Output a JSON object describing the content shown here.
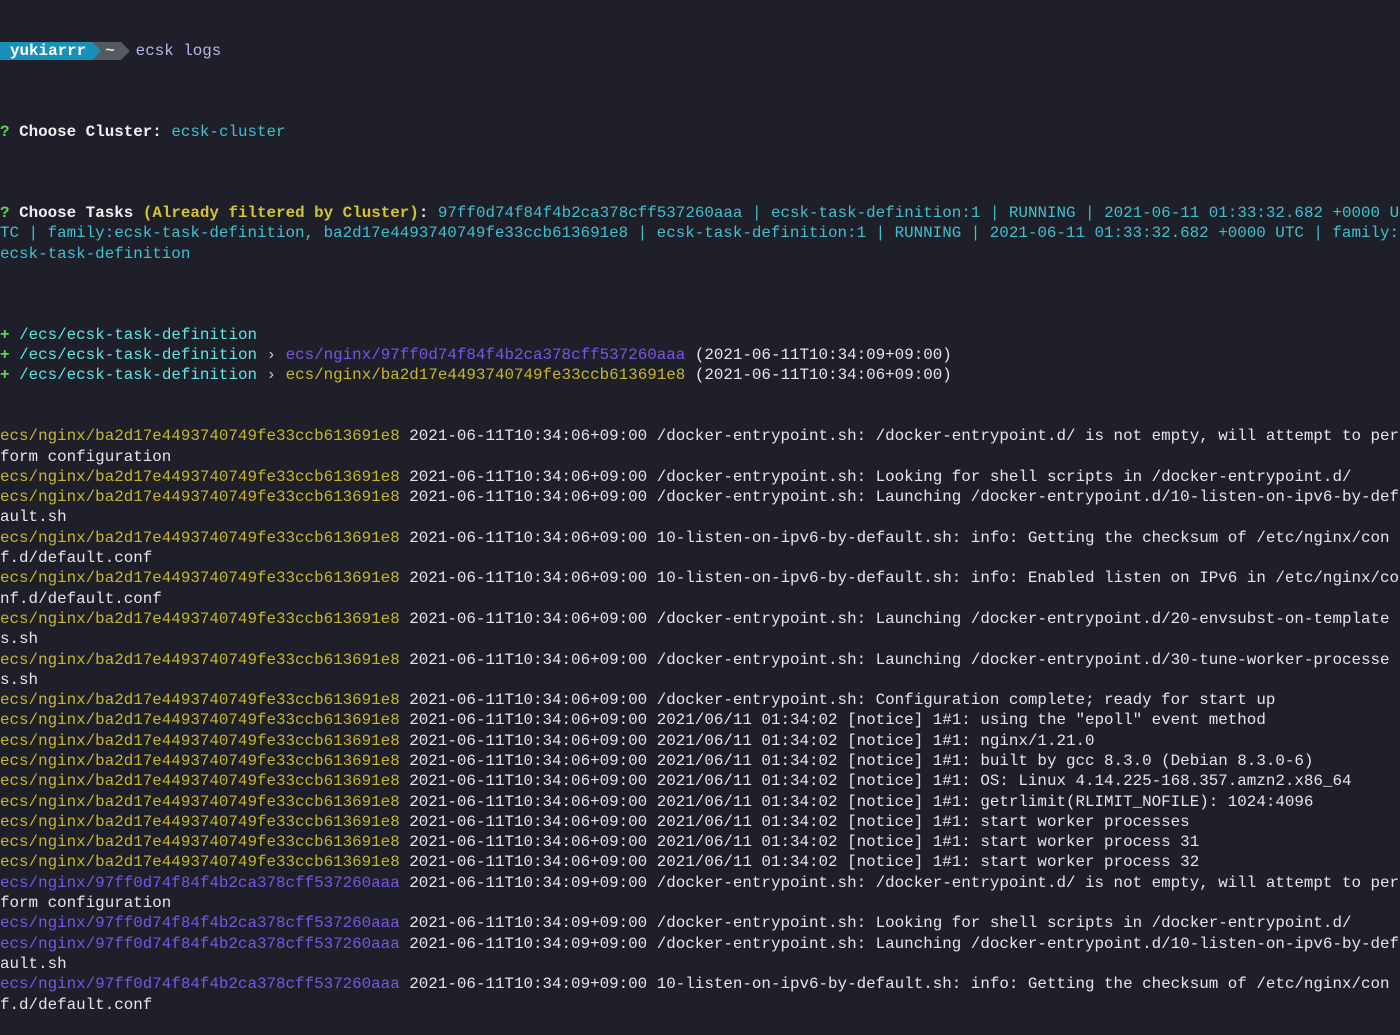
{
  "prompt": {
    "user": "yukiarrr",
    "dir": "~",
    "command": "ecsk logs",
    "colors": {
      "user_bg": "#1a8fb8",
      "dir_bg": "#555a5f"
    }
  },
  "questions": [
    {
      "mark": "?",
      "label": "Choose Cluster:",
      "hint": "",
      "answer": "ecsk-cluster"
    },
    {
      "mark": "?",
      "label": "Choose Tasks",
      "hint": "(Already filtered by Cluster)",
      "colon": ":",
      "answer": "97ff0d74f84f4b2ca378cff537260aaa | ecsk-task-definition:1 | RUNNING | 2021-06-11 01:33:32.682 +0000 UTC | family:ecsk-task-definition, ba2d17e4493740749fe33ccb613691e8 | ecsk-task-definition:1 | RUNNING | 2021-06-11 01:33:32.682 +0000 UTC | family:ecsk-task-definition"
    }
  ],
  "streams": [
    {
      "mark": "+",
      "group": "/ecs/ecsk-task-definition",
      "sep": "",
      "stream": "",
      "time": "",
      "color": ""
    },
    {
      "mark": "+",
      "group": "/ecs/ecsk-task-definition",
      "sep": " › ",
      "stream": "ecs/nginx/97ff0d74f84f4b2ca378cff537260aaa",
      "time": " (2021-06-11T10:34:09+09:00)",
      "color": "purple"
    },
    {
      "mark": "+",
      "group": "/ecs/ecsk-task-definition",
      "sep": " › ",
      "stream": "ecs/nginx/ba2d17e4493740749fe33ccb613691e8",
      "time": " (2021-06-11T10:34:06+09:00)",
      "color": "yellow"
    }
  ],
  "logs": [
    {
      "stream": "ecs/nginx/ba2d17e4493740749fe33ccb613691e8",
      "color": "yellow",
      "time": "2021-06-11T10:34:06+09:00",
      "msg": "/docker-entrypoint.sh: /docker-entrypoint.d/ is not empty, will attempt to perform configuration"
    },
    {
      "stream": "ecs/nginx/ba2d17e4493740749fe33ccb613691e8",
      "color": "yellow",
      "time": "2021-06-11T10:34:06+09:00",
      "msg": "/docker-entrypoint.sh: Looking for shell scripts in /docker-entrypoint.d/"
    },
    {
      "stream": "ecs/nginx/ba2d17e4493740749fe33ccb613691e8",
      "color": "yellow",
      "time": "2021-06-11T10:34:06+09:00",
      "msg": "/docker-entrypoint.sh: Launching /docker-entrypoint.d/10-listen-on-ipv6-by-default.sh"
    },
    {
      "stream": "ecs/nginx/ba2d17e4493740749fe33ccb613691e8",
      "color": "yellow",
      "time": "2021-06-11T10:34:06+09:00",
      "msg": "10-listen-on-ipv6-by-default.sh: info: Getting the checksum of /etc/nginx/conf.d/default.conf"
    },
    {
      "stream": "ecs/nginx/ba2d17e4493740749fe33ccb613691e8",
      "color": "yellow",
      "time": "2021-06-11T10:34:06+09:00",
      "msg": "10-listen-on-ipv6-by-default.sh: info: Enabled listen on IPv6 in /etc/nginx/conf.d/default.conf"
    },
    {
      "stream": "ecs/nginx/ba2d17e4493740749fe33ccb613691e8",
      "color": "yellow",
      "time": "2021-06-11T10:34:06+09:00",
      "msg": "/docker-entrypoint.sh: Launching /docker-entrypoint.d/20-envsubst-on-templates.sh"
    },
    {
      "stream": "ecs/nginx/ba2d17e4493740749fe33ccb613691e8",
      "color": "yellow",
      "time": "2021-06-11T10:34:06+09:00",
      "msg": "/docker-entrypoint.sh: Launching /docker-entrypoint.d/30-tune-worker-processes.sh"
    },
    {
      "stream": "ecs/nginx/ba2d17e4493740749fe33ccb613691e8",
      "color": "yellow",
      "time": "2021-06-11T10:34:06+09:00",
      "msg": "/docker-entrypoint.sh: Configuration complete; ready for start up"
    },
    {
      "stream": "ecs/nginx/ba2d17e4493740749fe33ccb613691e8",
      "color": "yellow",
      "time": "2021-06-11T10:34:06+09:00",
      "msg": "2021/06/11 01:34:02 [notice] 1#1: using the \"epoll\" event method"
    },
    {
      "stream": "ecs/nginx/ba2d17e4493740749fe33ccb613691e8",
      "color": "yellow",
      "time": "2021-06-11T10:34:06+09:00",
      "msg": "2021/06/11 01:34:02 [notice] 1#1: nginx/1.21.0"
    },
    {
      "stream": "ecs/nginx/ba2d17e4493740749fe33ccb613691e8",
      "color": "yellow",
      "time": "2021-06-11T10:34:06+09:00",
      "msg": "2021/06/11 01:34:02 [notice] 1#1: built by gcc 8.3.0 (Debian 8.3.0-6)"
    },
    {
      "stream": "ecs/nginx/ba2d17e4493740749fe33ccb613691e8",
      "color": "yellow",
      "time": "2021-06-11T10:34:06+09:00",
      "msg": "2021/06/11 01:34:02 [notice] 1#1: OS: Linux 4.14.225-168.357.amzn2.x86_64"
    },
    {
      "stream": "ecs/nginx/ba2d17e4493740749fe33ccb613691e8",
      "color": "yellow",
      "time": "2021-06-11T10:34:06+09:00",
      "msg": "2021/06/11 01:34:02 [notice] 1#1: getrlimit(RLIMIT_NOFILE): 1024:4096"
    },
    {
      "stream": "ecs/nginx/ba2d17e4493740749fe33ccb613691e8",
      "color": "yellow",
      "time": "2021-06-11T10:34:06+09:00",
      "msg": "2021/06/11 01:34:02 [notice] 1#1: start worker processes"
    },
    {
      "stream": "ecs/nginx/ba2d17e4493740749fe33ccb613691e8",
      "color": "yellow",
      "time": "2021-06-11T10:34:06+09:00",
      "msg": "2021/06/11 01:34:02 [notice] 1#1: start worker process 31"
    },
    {
      "stream": "ecs/nginx/ba2d17e4493740749fe33ccb613691e8",
      "color": "yellow",
      "time": "2021-06-11T10:34:06+09:00",
      "msg": "2021/06/11 01:34:02 [notice] 1#1: start worker process 32"
    },
    {
      "stream": "ecs/nginx/97ff0d74f84f4b2ca378cff537260aaa",
      "color": "purple",
      "time": "2021-06-11T10:34:09+09:00",
      "msg": "/docker-entrypoint.sh: /docker-entrypoint.d/ is not empty, will attempt to perform configuration"
    },
    {
      "stream": "ecs/nginx/97ff0d74f84f4b2ca378cff537260aaa",
      "color": "purple",
      "time": "2021-06-11T10:34:09+09:00",
      "msg": "/docker-entrypoint.sh: Looking for shell scripts in /docker-entrypoint.d/"
    },
    {
      "stream": "ecs/nginx/97ff0d74f84f4b2ca378cff537260aaa",
      "color": "purple",
      "time": "2021-06-11T10:34:09+09:00",
      "msg": "/docker-entrypoint.sh: Launching /docker-entrypoint.d/10-listen-on-ipv6-by-default.sh"
    },
    {
      "stream": "ecs/nginx/97ff0d74f84f4b2ca378cff537260aaa",
      "color": "purple",
      "time": "2021-06-11T10:34:09+09:00",
      "msg": "10-listen-on-ipv6-by-default.sh: info: Getting the checksum of /etc/nginx/conf.d/default.conf"
    }
  ],
  "colors": {
    "background": "#1e1f29",
    "text": "#e6e6e6",
    "yellow": "#c8b62e",
    "purple": "#7b55e8",
    "cyan": "#3ec1d0",
    "bright_cyan": "#5ee6e6",
    "green": "#5fd35f"
  }
}
